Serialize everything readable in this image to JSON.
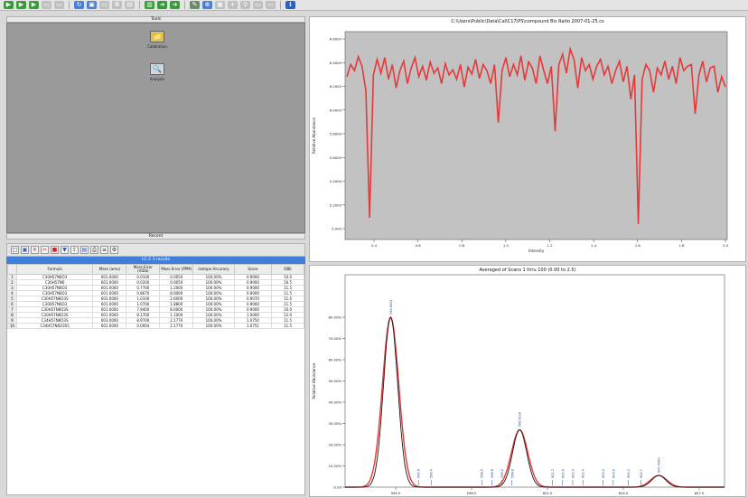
{
  "toolbar": {
    "icons": [
      {
        "name": "go-green-icon",
        "color": "#3a9a3a"
      },
      {
        "name": "go-green-icon",
        "color": "#3a9a3a"
      },
      {
        "name": "go-green-icon",
        "color": "#3a9a3a"
      },
      {
        "name": "document-icon",
        "color": "#bfbfbf"
      },
      {
        "name": "document-icon",
        "color": "#bfbfbf"
      },
      {
        "sep": true
      },
      {
        "name": "refresh-icon",
        "color": "#4a7fd0"
      },
      {
        "name": "save-icon",
        "color": "#4a7fd0"
      },
      {
        "name": "document-icon",
        "color": "#bfbfbf"
      },
      {
        "name": "copy-icon",
        "color": "#bfbfbf"
      },
      {
        "name": "paste-icon",
        "color": "#bfbfbf"
      },
      {
        "sep": true
      },
      {
        "name": "chart-icon",
        "color": "#3a9a3a"
      },
      {
        "name": "arrow-green-icon",
        "color": "#3a9a3a"
      },
      {
        "name": "arrow-green-icon",
        "color": "#3a9a3a"
      },
      {
        "sep": true
      },
      {
        "name": "pencil-icon",
        "color": "#6a8a6a"
      },
      {
        "name": "zoom-icon",
        "color": "#4a7fd0"
      },
      {
        "name": "grid-icon",
        "color": "#bfbfbf"
      },
      {
        "name": "plus-icon",
        "color": "#bfbfbf"
      },
      {
        "name": "pin-icon",
        "color": "#bfbfbf"
      },
      {
        "name": "document-icon",
        "color": "#bfbfbf"
      },
      {
        "name": "document-icon",
        "color": "#bfbfbf"
      },
      {
        "sep": true
      },
      {
        "name": "info-icon",
        "color": "#2d5fbf"
      }
    ]
  },
  "tools": {
    "header": "Tools",
    "footer": "Recent",
    "items": [
      {
        "name": "calibration-tool",
        "label": "Calibration",
        "glyph": "📁",
        "bg": "#d8c25a"
      },
      {
        "name": "analysis-tool",
        "label": "Analysis",
        "glyph": "🔍",
        "bg": "#cfd8e8"
      }
    ]
  },
  "results": {
    "title": "LC-2 3 results",
    "columns": [
      "",
      "Formula",
      "Mass (amu)",
      "Mass Error (mDa)",
      "Mass Error (PPM)",
      "Isotope Accuracy",
      "Score",
      "DBE"
    ],
    "rows": [
      [
        "1",
        "C30H57N6O3",
        "601.0000",
        "0.0100",
        "0.0050",
        "100.00%",
        "0.9000",
        "10.0"
      ],
      [
        "2",
        "C30H57N6",
        "601.0000",
        "0.0200",
        "0.0050",
        "100.00%",
        "0.9000",
        "10.5"
      ],
      [
        "3",
        "C30H57N6O3",
        "601.0000",
        "0.7700",
        "1.2000",
        "100.00%",
        "0.9000",
        "11.5"
      ],
      [
        "4",
        "C30H57N6O3",
        "601.0000",
        "0.8670",
        "8.0000",
        "100.00%",
        "0.9000",
        "11.5"
      ],
      [
        "5",
        "C30H57N6O3S",
        "601.0000",
        "1.0100",
        "2.6000",
        "100.00%",
        "0.9070",
        "11.0"
      ],
      [
        "6",
        "C30H57N6O3",
        "601.0000",
        "1.0700",
        "1.8800",
        "100.00%",
        "0.9000",
        "11.5"
      ],
      [
        "7",
        "C30H57N6O3S",
        "601.0000",
        "7.9400",
        "8.0000",
        "100.00%",
        "0.9000",
        "10.0"
      ],
      [
        "8",
        "C30H57N6O3S",
        "601.0000",
        "8.1700",
        "1.1000",
        "100.00%",
        "1.0000",
        "12.0"
      ],
      [
        "9",
        "C34H57N6O3S",
        "601.0000",
        "8.9700",
        "2.1770",
        "100.00%",
        "1.0750",
        "11.5"
      ],
      [
        "10",
        "C34H57N6O3S5",
        "601.0000",
        "0.0004",
        "2.1770",
        "100.00%",
        "1.0751",
        "11.5"
      ]
    ]
  },
  "colors": {
    "trace": "#e53a3a",
    "fit": "#1a1a1a",
    "plot_bg": "#c2c2c2",
    "accent": "#3f7fdc"
  },
  "chart_data": [
    {
      "type": "line",
      "title": "C:\\Users\\Public\\Data\\Cal\\C17\\PS\\compound Bis Ratio 2007-01-25.cs",
      "xlabel": "Intensity",
      "ylabel": "Relative Abundance",
      "xlim": [
        0.3,
        2.0
      ],
      "ylim": [
        0.0,
        7.0
      ],
      "xticks": [
        "0.4",
        "0.6",
        "0.8",
        "1.0",
        "1.2",
        "1.4",
        "1.6",
        "1.8",
        "2.0"
      ],
      "yticks": [
        "5.000",
        "5.2000",
        "5.4000",
        "5.6000",
        "5.8000",
        "6.0000",
        "6.2000",
        "6.4000",
        "6.6000"
      ],
      "y_values": [
        6.48,
        6.62,
        6.55,
        6.71,
        6.6,
        6.32,
        4.85,
        6.5,
        6.68,
        6.52,
        6.7,
        6.45,
        6.62,
        6.35,
        6.55,
        6.66,
        6.4,
        6.58,
        6.7,
        6.48,
        6.6,
        6.44,
        6.65,
        6.52,
        6.58,
        6.4,
        6.63,
        6.5,
        6.56,
        6.45,
        6.62,
        6.36,
        6.59,
        6.51,
        6.68,
        6.46,
        6.62,
        6.55,
        6.4,
        6.62,
        5.95,
        6.55,
        6.7,
        6.48,
        6.62,
        6.5,
        6.72,
        6.44,
        6.65,
        6.58,
        6.4,
        6.72,
        6.55,
        6.4,
        6.6,
        5.85,
        6.62,
        6.74,
        6.52,
        6.8,
        6.68,
        6.35,
        6.7,
        6.55,
        6.62,
        6.45,
        6.6,
        6.68,
        6.5,
        6.6,
        6.4,
        6.55,
        6.66,
        6.42,
        6.6,
        6.22,
        6.5,
        4.78,
        6.45,
        6.62,
        6.55,
        6.3,
        6.58,
        6.5,
        6.66,
        6.45,
        6.6,
        6.4,
        6.7,
        6.55,
        6.6,
        6.62,
        6.05,
        6.5,
        6.66,
        6.42,
        6.58,
        6.6,
        6.3,
        6.48,
        6.36
      ]
    },
    {
      "type": "line",
      "title": "Averaged of Scans 1 thru 100 (0.00 to 2.5)",
      "xlabel": "m/z",
      "ylabel": "Relative Abundance",
      "xlim": [
        593,
        608
      ],
      "ylim": [
        0,
        100
      ],
      "xticks": [
        "595.0",
        "598.0",
        "601.0",
        "604.0",
        "607.0"
      ],
      "yticks": [
        "0.00",
        "10.00%",
        "20.00%",
        "30.00%",
        "40.00%",
        "50.00%",
        "60.00%",
        "70.00%",
        "80.00%"
      ],
      "peaks": [
        {
          "center": 594.8,
          "height": 80,
          "width": 0.28,
          "label": "594.8001"
        },
        {
          "center": 599.9,
          "height": 27,
          "width": 0.28,
          "label": "599.9120"
        },
        {
          "center": 605.4,
          "height": 5.5,
          "width": 0.28,
          "label": "605.4050"
        }
      ],
      "markers": [
        {
          "x": 595.9,
          "label": "595.9"
        },
        {
          "x": 596.4,
          "label": "596.4"
        },
        {
          "x": 598.4,
          "label": "598.4"
        },
        {
          "x": 598.8,
          "label": "598.8"
        },
        {
          "x": 599.2,
          "label": "599.2"
        },
        {
          "x": 599.6,
          "label": "599.6"
        },
        {
          "x": 601.2,
          "label": "601.2"
        },
        {
          "x": 601.6,
          "label": "601.6"
        },
        {
          "x": 602.0,
          "label": "602.0"
        },
        {
          "x": 602.4,
          "label": "602.4"
        },
        {
          "x": 603.2,
          "label": "603.2"
        },
        {
          "x": 603.6,
          "label": "603.6"
        },
        {
          "x": 604.2,
          "label": "604.2"
        },
        {
          "x": 604.7,
          "label": "604.7"
        }
      ]
    }
  ]
}
